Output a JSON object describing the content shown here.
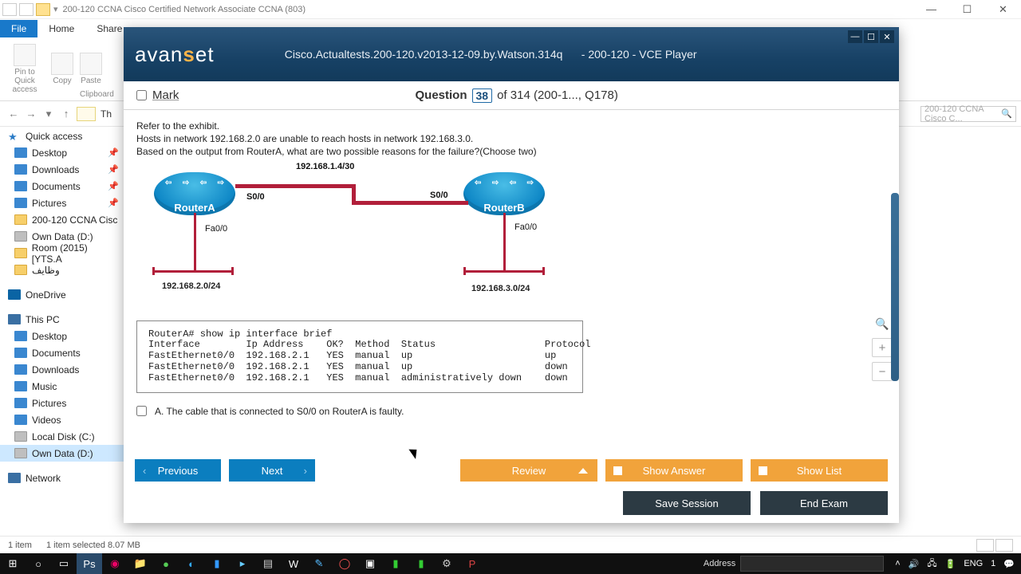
{
  "explorer": {
    "title": "200-120 CCNA Cisco Certified Network Associate CCNA (803)",
    "tabs": {
      "file": "File",
      "home": "Home",
      "share": "Share"
    },
    "ribbon": {
      "pin": "Pin to Quick access",
      "copy": "Copy",
      "paste": "Paste",
      "clipboard": "Clipboard"
    },
    "nav": {
      "crumb": "Th",
      "search": "200-120 CCNA Cisco C..."
    },
    "tree": {
      "quick": "Quick access",
      "items1": [
        "Desktop",
        "Downloads",
        "Documents",
        "Pictures",
        "200-120 CCNA Cisc",
        "Own Data (D:)",
        "Room (2015) [YTS.A",
        "وظايف"
      ],
      "onedrive": "OneDrive",
      "thispc": "This PC",
      "items2": [
        "Desktop",
        "Documents",
        "Downloads",
        "Music",
        "Pictures",
        "Videos",
        "Local Disk (C:)",
        "Own Data (D:)"
      ],
      "network": "Network"
    },
    "status": {
      "left": "1 item",
      "mid": "1 item selected  8.07 MB"
    }
  },
  "vce": {
    "brand_a": "avan",
    "brand_b": "s",
    "brand_c": "et",
    "doc": "Cisco.Actualtests.200-120.v2013-12-09.by.Watson.314q",
    "player": "- 200-120 - VCE Player",
    "mark": "Mark",
    "qword": "Question",
    "qnum": "38",
    "qtotal": "of 314 (200-1..., Q178)",
    "text1": "Refer to the exhibit.",
    "text2": "Hosts in network 192.168.2.0 are unable to reach hosts in network 192.168.3.0.",
    "text3": "Based on the output from RouterA, what are two possible reasons for the failure?(Choose two)",
    "diagram": {
      "wan": "192.168.1.4/30",
      "s0a": "S0/0",
      "s0b": "S0/0",
      "ra": "RouterA",
      "rb": "RouterB",
      "faA": "Fa0/0",
      "faB": "Fa0/0",
      "netA": "192.168.2.0/24",
      "netB": "192.168.3.0/24"
    },
    "cli": "RouterA# show ip interface brief\nInterface        Ip Address    OK?  Method  Status                   Protocol\nFastEthernet0/0  192.168.2.1   YES  manual  up                       up\nFastEthernet0/0  192.168.2.1   YES  manual  up                       down\nFastEthernet0/0  192.168.2.1   YES  manual  administratively down    down",
    "answerA": "A.   The cable that is connected to S0/0 on RouterA is faulty.",
    "btn": {
      "prev": "Previous",
      "next": "Next",
      "review": "Review",
      "show": "Show Answer",
      "list": "Show List",
      "save": "Save Session",
      "end": "End Exam"
    }
  },
  "taskbar": {
    "address": "Address",
    "lang": "ENG",
    "time": "1"
  }
}
